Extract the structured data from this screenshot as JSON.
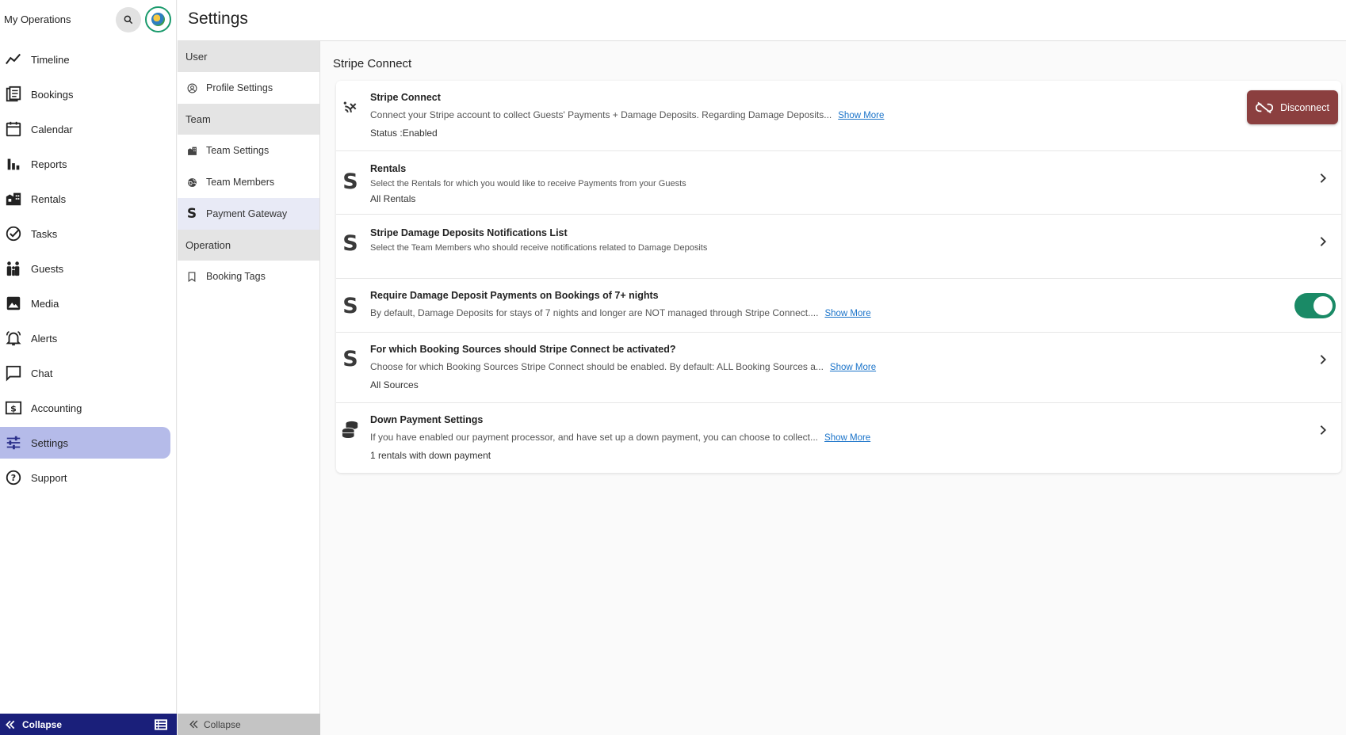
{
  "sidebar": {
    "title": "My Operations",
    "items": [
      {
        "label": "Timeline",
        "icon": "timeline-icon"
      },
      {
        "label": "Bookings",
        "icon": "bookings-icon"
      },
      {
        "label": "Calendar",
        "icon": "calendar-icon"
      },
      {
        "label": "Reports",
        "icon": "bar-chart-icon"
      },
      {
        "label": "Rentals",
        "icon": "building-icon"
      },
      {
        "label": "Tasks",
        "icon": "check-circle-icon"
      },
      {
        "label": "Guests",
        "icon": "family-icon"
      },
      {
        "label": "Media",
        "icon": "image-icon"
      },
      {
        "label": "Alerts",
        "icon": "bell-icon"
      },
      {
        "label": "Chat",
        "icon": "chat-icon"
      },
      {
        "label": "Accounting",
        "icon": "dollar-icon"
      },
      {
        "label": "Settings",
        "icon": "sliders-icon",
        "active": true
      },
      {
        "label": "Support",
        "icon": "help-icon"
      }
    ],
    "collapse_label": "Collapse"
  },
  "header": {
    "title": "Settings"
  },
  "subnav": {
    "sections": {
      "user": "User",
      "team": "Team",
      "operation": "Operation"
    },
    "items": {
      "profile": "Profile Settings",
      "team_settings": "Team Settings",
      "team_members": "Team Members",
      "payment_gateway": "Payment Gateway",
      "booking_tags": "Booking Tags"
    },
    "active": "Payment Gateway",
    "collapse_label": "Collapse"
  },
  "main": {
    "section_title": "Stripe Connect",
    "rows": [
      {
        "title": "Stripe Connect",
        "desc": "Connect your Stripe account to collect Guests' Payments + Damage Deposits. Regarding Damage Deposits...",
        "show_more": "Show More",
        "sub": "Status :Enabled",
        "action": "Disconnect"
      },
      {
        "title": "Rentals",
        "desc": "Select the Rentals for which you would like to receive Payments from your Guests",
        "sub": "All Rentals"
      },
      {
        "title": "Stripe Damage Deposits Notifications List",
        "desc": "Select the Team Members who should receive notifications related to Damage Deposits"
      },
      {
        "title": "Require Damage Deposit Payments on Bookings of 7+ nights",
        "desc": "By default, Damage Deposits for stays of 7 nights and longer are NOT managed through Stripe Connect....",
        "show_more": "Show More",
        "toggle_on": true
      },
      {
        "title": "For which Booking Sources should Stripe Connect be activated?",
        "desc": "Choose for which Booking Sources Stripe Connect should be enabled. By default: ALL Booking Sources a...",
        "show_more": "Show More",
        "sub": "All Sources"
      },
      {
        "title": "Down Payment Settings",
        "desc": "If you have enabled our payment processor, and have set up a down payment, you can choose to collect...",
        "show_more": "Show More",
        "sub": "1 rentals with down payment"
      }
    ]
  },
  "colors": {
    "active_nav": "#b5bbe9",
    "footer_bar": "#1a1f7a",
    "disconnect": "#8b3f3f",
    "toggle": "#1a8a66",
    "link": "#1a73c9"
  }
}
